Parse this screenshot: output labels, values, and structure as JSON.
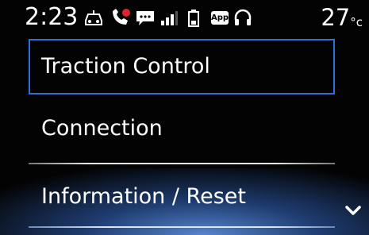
{
  "status_bar": {
    "time": "2:23",
    "temperature": "27",
    "temperature_unit": "°c",
    "app_badge": "App",
    "icons": [
      "vehicle-icon",
      "phone-missed-icon",
      "message-icon",
      "signal-icon",
      "battery-icon",
      "app-icon",
      "headset-icon"
    ]
  },
  "menu": {
    "items": [
      {
        "label": "Traction Control",
        "focused": true
      },
      {
        "label": "Connection",
        "focused": false
      },
      {
        "label": "Information / Reset",
        "focused": false
      }
    ]
  },
  "colors": {
    "focus_border": "#2f6fd6",
    "missed_call": "#e0242a",
    "background": "#030303"
  }
}
